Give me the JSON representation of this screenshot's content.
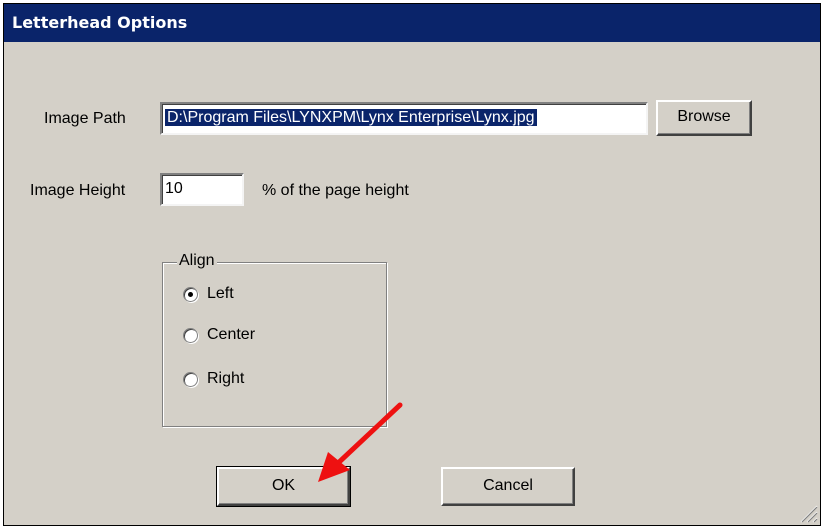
{
  "window": {
    "title": "Letterhead Options"
  },
  "image_path": {
    "label": "Image Path",
    "value": "D:\\Program Files\\LYNXPM\\Lynx Enterprise\\Lynx.jpg",
    "browse_label": "Browse"
  },
  "image_height": {
    "label": "Image Height",
    "value": "10",
    "suffix": "% of the page height"
  },
  "align": {
    "legend": "Align",
    "options": [
      {
        "label": "Left",
        "checked": true
      },
      {
        "label": "Center",
        "checked": false
      },
      {
        "label": "Right",
        "checked": false
      }
    ]
  },
  "buttons": {
    "ok": "OK",
    "cancel": "Cancel"
  },
  "annotation": {
    "arrow_color": "#ee1111"
  }
}
